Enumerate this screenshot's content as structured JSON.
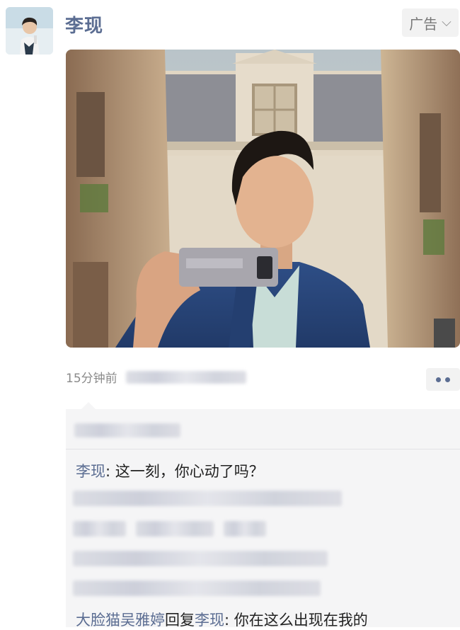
{
  "post": {
    "author": "李现",
    "ad_label": "广告",
    "time_ago": "15分钟前"
  },
  "comments": [
    {
      "author": "李现",
      "separator": ": ",
      "text": "这一刻，你心动了吗？"
    },
    {
      "author": "大脸猫吴雅婷",
      "reply_word": "回复",
      "reply_to": "李现",
      "separator": ": ",
      "text": "你在这么出现在我的"
    }
  ],
  "colors": {
    "name_link": "#5b6d92",
    "comment_bg": "#f5f5f6",
    "badge_bg": "#f2f2f2"
  }
}
